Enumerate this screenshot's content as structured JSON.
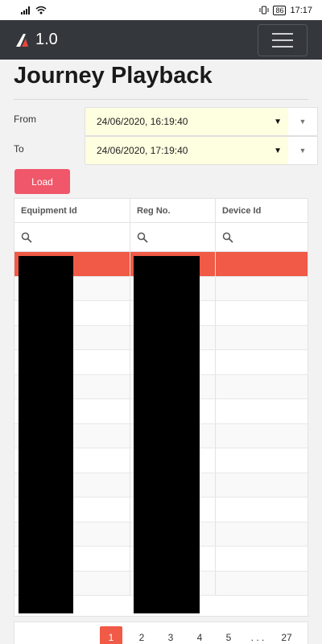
{
  "status_bar": {
    "battery": "86",
    "time": "17:17"
  },
  "app": {
    "version": "1.0"
  },
  "page": {
    "title": "Journey Playback"
  },
  "filters": {
    "from_label": "From",
    "from_value": "24/06/2020, 16:19:40",
    "to_label": "To",
    "to_value": "24/06/2020, 17:19:40"
  },
  "load_label": "Load",
  "table": {
    "columns": [
      "Equipment Id",
      "Reg No.",
      "Device Id"
    ],
    "selected_row": 0,
    "row_count": 14
  },
  "pagination": {
    "pages": [
      "1",
      "2",
      "3",
      "4",
      "5",
      ". . .",
      "27"
    ],
    "active_page": "1"
  },
  "colors": {
    "app_bar": "#34373b",
    "accent": "#f05a46",
    "load_button": "#f0576a",
    "date_input_bg": "#fefee0"
  }
}
